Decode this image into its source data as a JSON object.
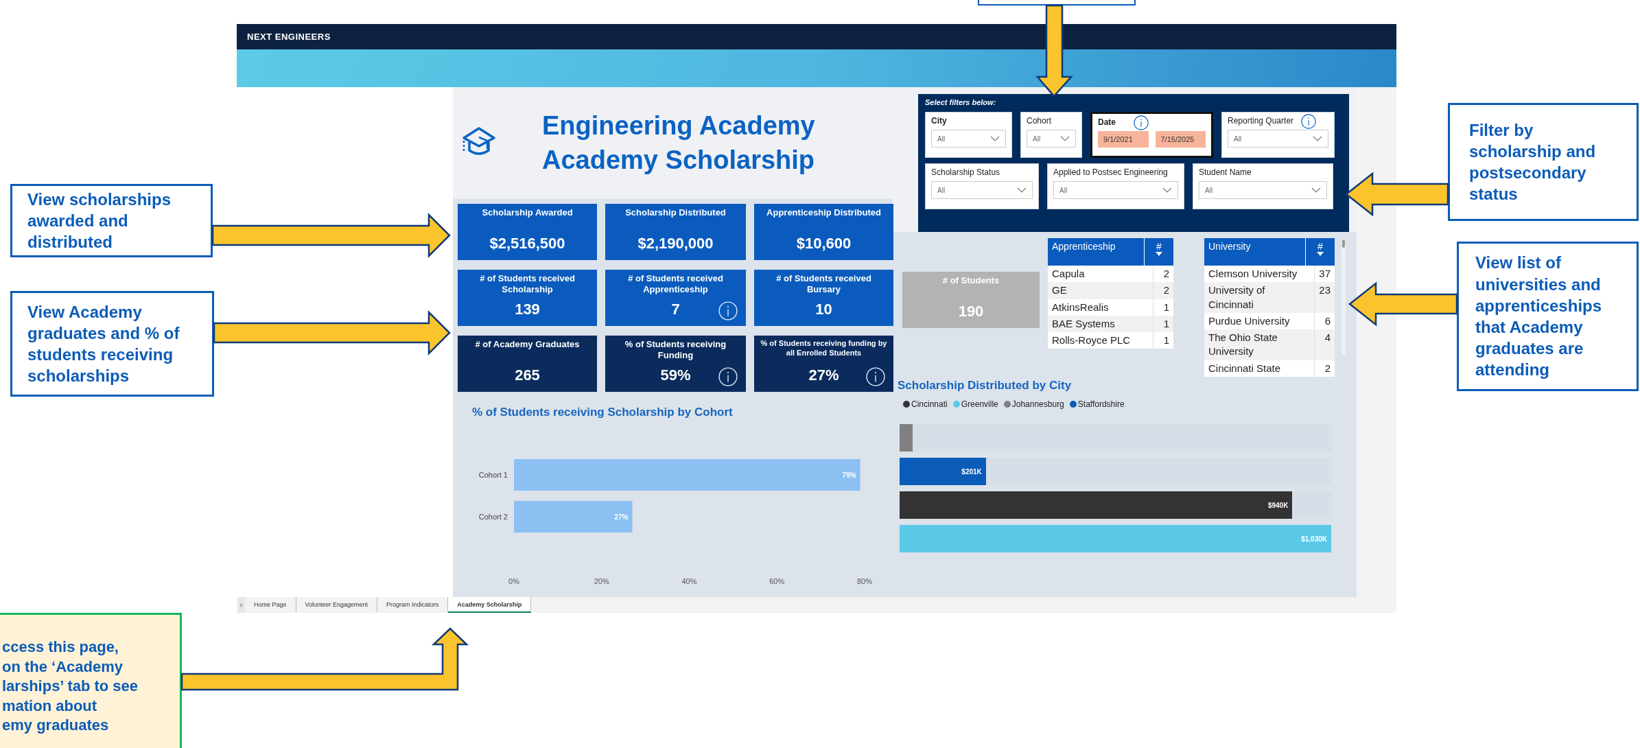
{
  "callouts": [
    {
      "kind": "info",
      "text": "View scholarships\nawarded and\ndistributed"
    },
    {
      "kind": "info",
      "text": "View Academy\ngraduates and % of\nstudents receiving\nscholarships"
    },
    {
      "kind": "info",
      "text": "Filter by\nscholarship and\npostsecondary\nstatus"
    },
    {
      "kind": "info",
      "text": "View list of\nuniversities and\napprenticeships\nthat Academy\ngraduates are\nattending"
    },
    {
      "kind": "access",
      "text": "ccess this page,\non the ‘Academy\nlarships’ tab to see\nmation about\nemy graduates"
    }
  ],
  "dashboard": {
    "brand": "NEXT ENGINEERS",
    "title": "Engineering Academy\nAcademy Scholarship",
    "filters": {
      "heading": "Select filters below:",
      "items": [
        {
          "kind": "dropdown",
          "label": "City",
          "value": "All",
          "emphasized": true,
          "focused": false,
          "info": false
        },
        {
          "kind": "dropdown",
          "label": "Cohort",
          "value": "All",
          "emphasized": false,
          "focused": false,
          "info": false
        },
        {
          "kind": "date_range",
          "label": "Date",
          "start": "9/1/2021",
          "end": "7/15/2025",
          "emphasized": true,
          "focused": true,
          "info": true
        },
        {
          "kind": "dropdown",
          "label": "Reporting Quarter",
          "value": "All",
          "emphasized": false,
          "focused": false,
          "info": true
        },
        {
          "kind": "dropdown",
          "label": "Scholarship Status",
          "value": "All",
          "emphasized": false,
          "focused": false,
          "info": false
        },
        {
          "kind": "dropdown",
          "label": "Applied to Postsec Engineering",
          "value": "All",
          "emphasized": false,
          "focused": false,
          "info": false
        },
        {
          "kind": "dropdown",
          "label": "Student Name",
          "value": "All",
          "emphasized": false,
          "focused": false,
          "info": false
        }
      ]
    },
    "kpis": [
      {
        "label": "Scholarship Awarded",
        "value": "$2,516,500",
        "color": "#0a5bbd",
        "info": false,
        "small": false
      },
      {
        "label": "Scholarship Distributed",
        "value": "$2,190,000",
        "color": "#0a5bbd",
        "info": false,
        "small": false
      },
      {
        "label": "Apprenticeship Distributed",
        "value": "$10,600",
        "color": "#0a5bbd",
        "info": false,
        "small": false
      },
      {
        "label": "# of Students received Scholarship",
        "value": "139",
        "color": "#0a5bbd",
        "info": false,
        "small": false
      },
      {
        "label": "# of Students received Apprenticeship",
        "value": "7",
        "color": "#0a5bbd",
        "info": true,
        "small": false
      },
      {
        "label": "# of Students received Bursary",
        "value": "10",
        "color": "#0a5bbd",
        "info": false,
        "small": false
      },
      {
        "label": "# of Academy Graduates",
        "value": "265",
        "color": "#0a2b5c",
        "info": false,
        "small": false
      },
      {
        "label": "% of Students receiving Funding",
        "value": "59%",
        "color": "#0a2b5c",
        "info": true,
        "small": false
      },
      {
        "label": "% of Students receiving funding by all Enrolled Students",
        "value": "27%",
        "color": "#0a2b5c",
        "info": true,
        "small": true
      }
    ],
    "students_card": {
      "label": "# of Students",
      "value": "190",
      "color": "#b3b3b3"
    },
    "apprenticeship_table": {
      "columns": [
        "Apprenticeship",
        "#"
      ],
      "rows": [
        [
          "Capula",
          "2"
        ],
        [
          "GE",
          "2"
        ],
        [
          "AtkinsRealis",
          "1"
        ],
        [
          "BAE Systems",
          "1"
        ],
        [
          "Rolls-Royce PLC",
          "1"
        ]
      ]
    },
    "university_table": {
      "columns": [
        "University",
        "#"
      ],
      "rows": [
        [
          "Clemson University",
          "37"
        ],
        [
          "University of Cincinnati",
          "23"
        ],
        [
          "Purdue University",
          "6"
        ],
        [
          "The Ohio State University",
          "4"
        ],
        [
          "Cincinnati State",
          "2"
        ]
      ]
    },
    "cohort_chart": {
      "chart_data": {
        "type": "bar",
        "orientation": "horizontal",
        "title": "% of Students receiving Scholarship by Cohort",
        "categories": [
          "Cohort 1",
          "Cohort 2"
        ],
        "series": [
          {
            "color": "#8cc0f2",
            "values": [
              79,
              27
            ]
          }
        ],
        "value_labels": [
          "79%",
          "27%"
        ],
        "xlim": [
          0,
          80
        ],
        "xticks": [
          {
            "value": 0,
            "label": "0%"
          },
          {
            "value": 20,
            "label": "20%"
          },
          {
            "value": 40,
            "label": "40%"
          },
          {
            "value": 60,
            "label": "60%"
          },
          {
            "value": 80,
            "label": "80%"
          }
        ]
      }
    },
    "city_chart": {
      "title": "Scholarship Distributed by City",
      "legend": [
        {
          "name": "Cincinnati",
          "color": "#333333"
        },
        {
          "name": "Greenville",
          "color": "#5bc8e8"
        },
        {
          "name": "Johannesburg",
          "color": "#808080"
        },
        {
          "name": "Staffordshire",
          "color": "#0b5cb8"
        }
      ],
      "bars": [
        {
          "color": "#808080",
          "level": 0.03
        },
        {
          "color": "#0b5cb8",
          "level": 0.2,
          "label": "$201K"
        },
        {
          "color": "#333333",
          "level": 0.91,
          "label": "$940K"
        },
        {
          "color": "#5bc8e8",
          "level": 1,
          "label": "$1,030K"
        }
      ]
    },
    "tabs": [
      {
        "label": "Home Page",
        "selected": false
      },
      {
        "label": "Volunteer Engagement",
        "selected": false
      },
      {
        "label": "Program Indicators",
        "selected": false
      },
      {
        "label": "Academy Scholarship",
        "selected": true
      }
    ]
  }
}
